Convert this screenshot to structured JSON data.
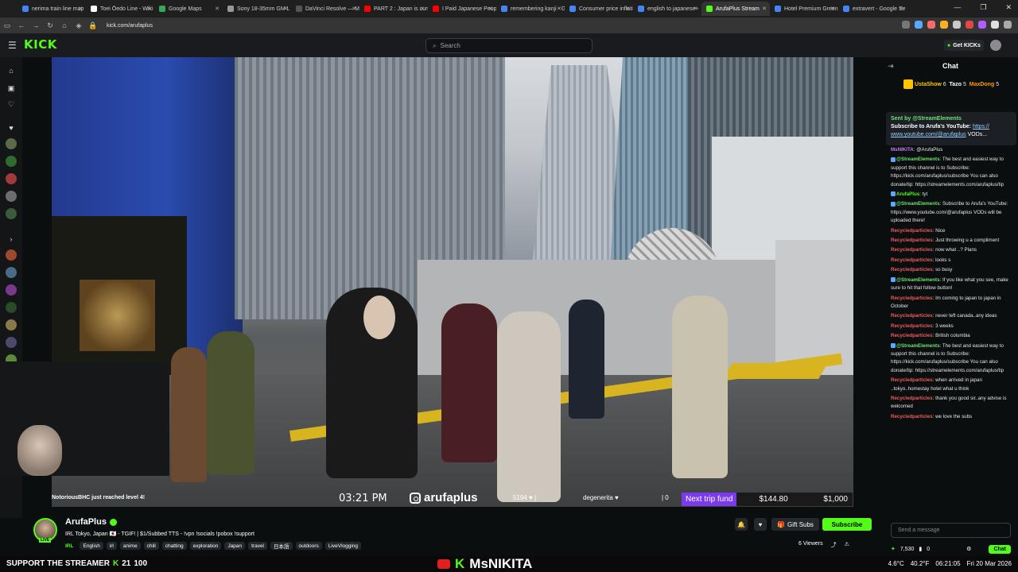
{
  "browser": {
    "tabs": [
      {
        "label": "nerima train line map",
        "color": "#4285f4",
        "active": false
      },
      {
        "label": "Toei Ōedo Line - Wiki",
        "color": "#ffffff",
        "active": false
      },
      {
        "label": "Google Maps",
        "color": "#34a853",
        "active": false
      },
      {
        "label": "Sony 18-35mm GM L",
        "color": "#999999",
        "active": false
      },
      {
        "label": "DaVinci Resolve — M",
        "color": "#555555",
        "active": false
      },
      {
        "label": "PART 2 : Japan is curr",
        "color": "#ff0000",
        "active": false
      },
      {
        "label": "I Paid Japanese Peopl",
        "color": "#ff0000",
        "active": false
      },
      {
        "label": "remembering kanji - G",
        "color": "#4285f4",
        "active": false
      },
      {
        "label": "Consumer price inflati",
        "color": "#4285f4",
        "active": false
      },
      {
        "label": "english to japanese -",
        "color": "#4285f4",
        "active": false
      },
      {
        "label": "ArufaPlus Stream",
        "color": "#53fc18",
        "active": true
      },
      {
        "label": "Hotel Premium Green",
        "color": "#4285f4",
        "active": false
      },
      {
        "label": "extravert - Google Se",
        "color": "#4285f4",
        "active": false
      }
    ],
    "url": "kick.com/arufaplus"
  },
  "header": {
    "logo": "KICK",
    "search_placeholder": "Search",
    "get_kicks": "Get KICKs"
  },
  "overlay": {
    "follower_text": "NotoriousBHC just reached level 4!",
    "time": "03:21 PM",
    "handle": "arufaplus",
    "stat1": "5194 ♥ |",
    "stat2": "degenerita ♥",
    "stat3": "| 0",
    "trip_label": "Next trip fund",
    "trip_current": "$144.80",
    "trip_goal": "$1,000"
  },
  "chat": {
    "title": "Chat",
    "leaders": [
      {
        "name": "UstaShow",
        "count": "6"
      },
      {
        "name": "Tazo",
        "count": "5"
      },
      {
        "name": "MaxDong",
        "count": "5"
      }
    ],
    "pinned": {
      "header": "Sent by @StreamElements",
      "text": "Subscribe to Arufa's YouTube:",
      "link": "https:// www.youtube.com/@arufaplus",
      "tail": "VODs..."
    },
    "messages": [
      {
        "user": "MsNIKITA",
        "cls": "u-mn",
        "text": ": @ArufaPlus"
      },
      {
        "user": "@StreamElements",
        "cls": "u-se",
        "text": ": The best and easiest way to support this channel is to Subscribe: https://kick.com/arufaplus/subscribe You can also donate/tip: https://streamelements.com/arufaplus/tip"
      },
      {
        "user": "ArufaPlus",
        "cls": "u-ap",
        "text": ": tyt"
      },
      {
        "user": "@StreamElements",
        "cls": "u-se",
        "text": ": Subscribe to Arufa's YouTube: https://www.youtube.com/@arufaplus VODs will be uploaded there!"
      },
      {
        "user": "Recycledparticles",
        "cls": "u-rp",
        "text": ": Nice"
      },
      {
        "user": "Recycledparticles",
        "cls": "u-rp",
        "text": ": Just throwing u a compliment"
      },
      {
        "user": "Recycledparticles",
        "cls": "u-rp",
        "text": ": now what ..? Plans"
      },
      {
        "user": "Recycledparticles",
        "cls": "u-rp",
        "text": ": looks s"
      },
      {
        "user": "Recycledparticles",
        "cls": "u-rp",
        "text": ": so busy"
      },
      {
        "user": "@StreamElements",
        "cls": "u-se",
        "text": ": If you like what you see, make sure to hit that follow button!"
      },
      {
        "user": "Recycledparticles",
        "cls": "u-rp",
        "text": ": Im coming to japan to japan in October"
      },
      {
        "user": "Recycledparticles",
        "cls": "u-rp",
        "text": ": never left canada..any ideas"
      },
      {
        "user": "Recycledparticles",
        "cls": "u-rp",
        "text": ": 3 weeks"
      },
      {
        "user": "Recycledparticles",
        "cls": "u-rp",
        "text": ": British columbia"
      },
      {
        "user": "@StreamElements",
        "cls": "u-se",
        "text": ": The best and easiest way to support this channel is to Subscribe: https://kick.com/arufaplus/subscribe You can also donate/tip: https://streamelements.com/arufaplus/tip"
      },
      {
        "user": "Recycledparticles",
        "cls": "u-rp",
        "text": ": when arrived in japan ..tokyo..homestay hotel what u think"
      },
      {
        "user": "Recycledparticles",
        "cls": "u-rp",
        "text": ": thank you good sir..any advise is welcomed"
      },
      {
        "user": "Recycledparticles",
        "cls": "u-rp",
        "text": ": we love the subs"
      }
    ],
    "input_placeholder": "Send a message",
    "points": "7,530",
    "kicks": "0",
    "chat_button": "Chat"
  },
  "channel": {
    "name": "ArufaPlus",
    "live_badge": "LIVE",
    "title": "IRL Tokyo, Japan 🇯🇵 - TGIF! | $1/Subbed TTS - !vpn !socials !pobox !support",
    "category": "IRL",
    "tags": [
      "English",
      "irl",
      "anime",
      "chill",
      "chatting",
      "exploration",
      "Japan",
      "travel",
      "日本語",
      "outdoors",
      "LiveVlogging"
    ],
    "gift_subs": "Gift Subs",
    "subscribe": "Subscribe",
    "viewers": "6 Viewers"
  },
  "taskbar": {
    "left_text": "SUPPORT THE STREAMER",
    "left_num1": "21",
    "left_num2": "100",
    "center_text": "MsNIKITA",
    "weather": "4.6°C",
    "temp": "40.2°F",
    "clock": "06:21:05",
    "date": "Fri 20 Mar 2026"
  },
  "colors": {
    "kick_green": "#53fc18",
    "trip_purple": "#7c3aed",
    "chat_bg": "#0b0e0f"
  }
}
